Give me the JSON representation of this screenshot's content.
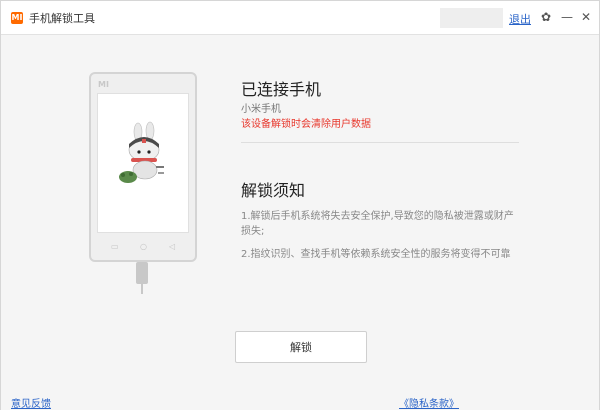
{
  "titlebar": {
    "logo": "MI",
    "title": "手机解锁工具",
    "logout": "退出"
  },
  "phone": {
    "brand": "MI",
    "softkeys": [
      "▭",
      "○",
      "◁"
    ]
  },
  "connection": {
    "title": "已连接手机",
    "device": "小米手机",
    "warning": "该设备解锁时会清除用户数据"
  },
  "notice": {
    "title": "解锁须知",
    "items": [
      "1.解锁后手机系统将失去安全保护,导致您的隐私被泄露或财产损失;",
      "2.指纹识别、查找手机等依赖系统安全性的服务将变得不可靠"
    ]
  },
  "actions": {
    "unlock_label": "解锁"
  },
  "footer": {
    "feedback": "意见反馈",
    "privacy": "《隐私条款》"
  },
  "colors": {
    "brand": "#ff6a00",
    "warning": "#e8372c",
    "link": "#2a64c8"
  }
}
